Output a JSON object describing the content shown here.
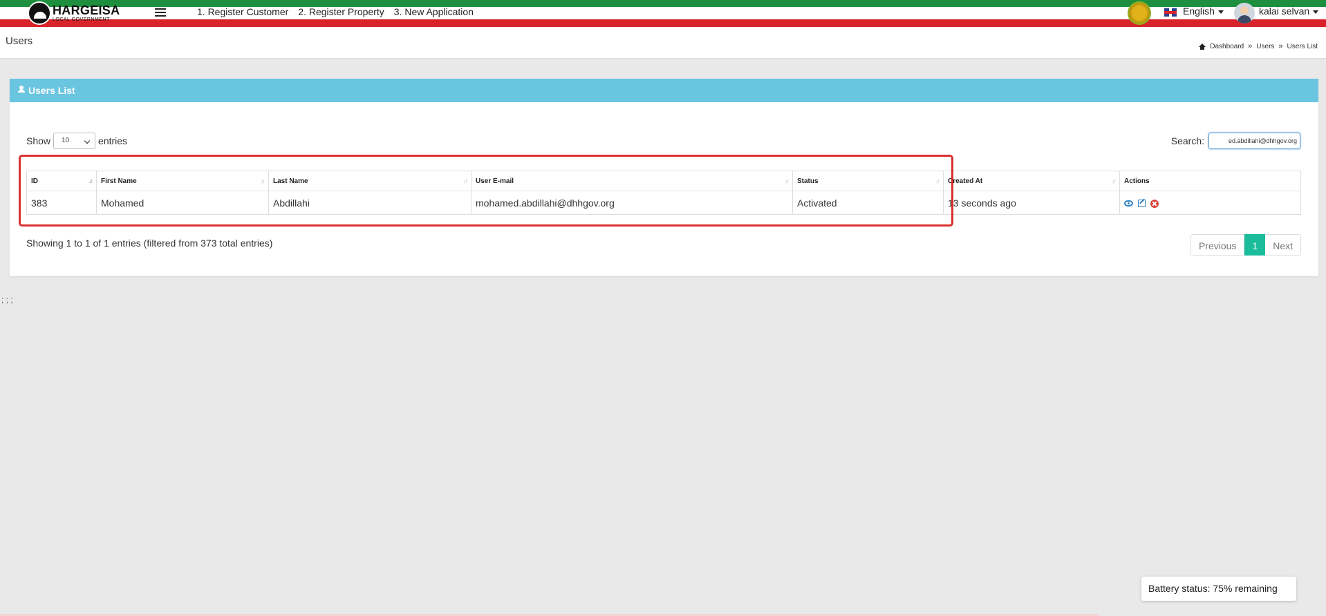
{
  "navbar": {
    "logo_title": "HARGEISA",
    "logo_subtitle": "LOCAL GOVERNMENT",
    "links": [
      "1. Register Customer",
      "2. Register Property",
      "3. New Application"
    ],
    "language": "English",
    "user_name": "kalai selvan",
    "colors": {
      "green": "#1e8f3e",
      "red": "#d9232a"
    }
  },
  "page": {
    "title": "Users",
    "breadcrumb": [
      "Dashboard",
      "Users",
      "Users List"
    ]
  },
  "panel": {
    "heading": "Users List",
    "show_label": "Show",
    "entries_count": "10",
    "entries_label": "entries",
    "search_label": "Search:",
    "search_value": "ed.abdillahi@dhhgov.org"
  },
  "table": {
    "columns": [
      "ID",
      "First Name",
      "Last Name",
      "User E-mail",
      "Status",
      "Created At",
      "Actions"
    ],
    "rows": [
      {
        "id": "383",
        "first_name": "Mohamed",
        "last_name": "Abdillahi",
        "email": "mohamed.abdillahi@dhhgov.org",
        "status": "Activated",
        "created_at": "13 seconds ago"
      }
    ]
  },
  "footer": {
    "info": "Showing 1 to 1 of 1 entries (filtered from 373 total entries)",
    "previous": "Previous",
    "current_page": "1",
    "next": "Next"
  },
  "stray_text": "; ; ;",
  "toast": "Battery status: 75% remaining",
  "accent_colors": {
    "panel_heading": "#6ac5e0",
    "active_page": "#1abc9c",
    "highlight": "#d9302f"
  }
}
